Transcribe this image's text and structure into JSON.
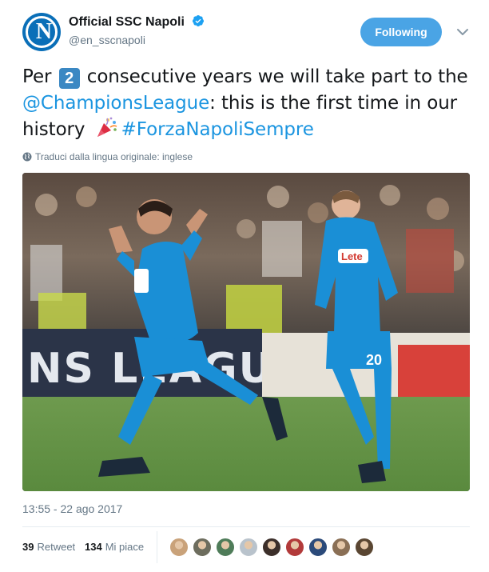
{
  "account": {
    "display_name": "Official SSC Napoli",
    "handle": "@en_sscnapoli",
    "avatar_letter": "N",
    "verified": true,
    "follow_label": "Following"
  },
  "tweet": {
    "part1": "Per ",
    "keycap": "2",
    "part2": " consecutive years we will take part to the ",
    "mention": "@ChampionsLeague",
    "part3": ": this is the first time in our history ",
    "hashtag": "#ForzaNapoliSempre",
    "translate_label": "Traduci dalla lingua originale: inglese"
  },
  "photo": {
    "banner_text": "NS LEAGUE",
    "sponsor_text": "Lete",
    "shirt_number": "20"
  },
  "meta": {
    "timestamp": "13:55 - 22 ago 2017",
    "retweets_count": "39",
    "retweets_label": "Retweet",
    "likes_count": "134",
    "likes_label": "Mi piace"
  },
  "colors": {
    "link": "#1b95e0",
    "follow_button": "#4aa4e5",
    "muted": "#657786",
    "napoli_blue": "#1a8fd6"
  },
  "likers": [
    "#c9a27a",
    "#6d6d5e",
    "#4f7c59",
    "#b9c3cc",
    "#3c2f2a",
    "#b23a3a",
    "#2b4a7a",
    "#8a6f55",
    "#5a4632"
  ]
}
